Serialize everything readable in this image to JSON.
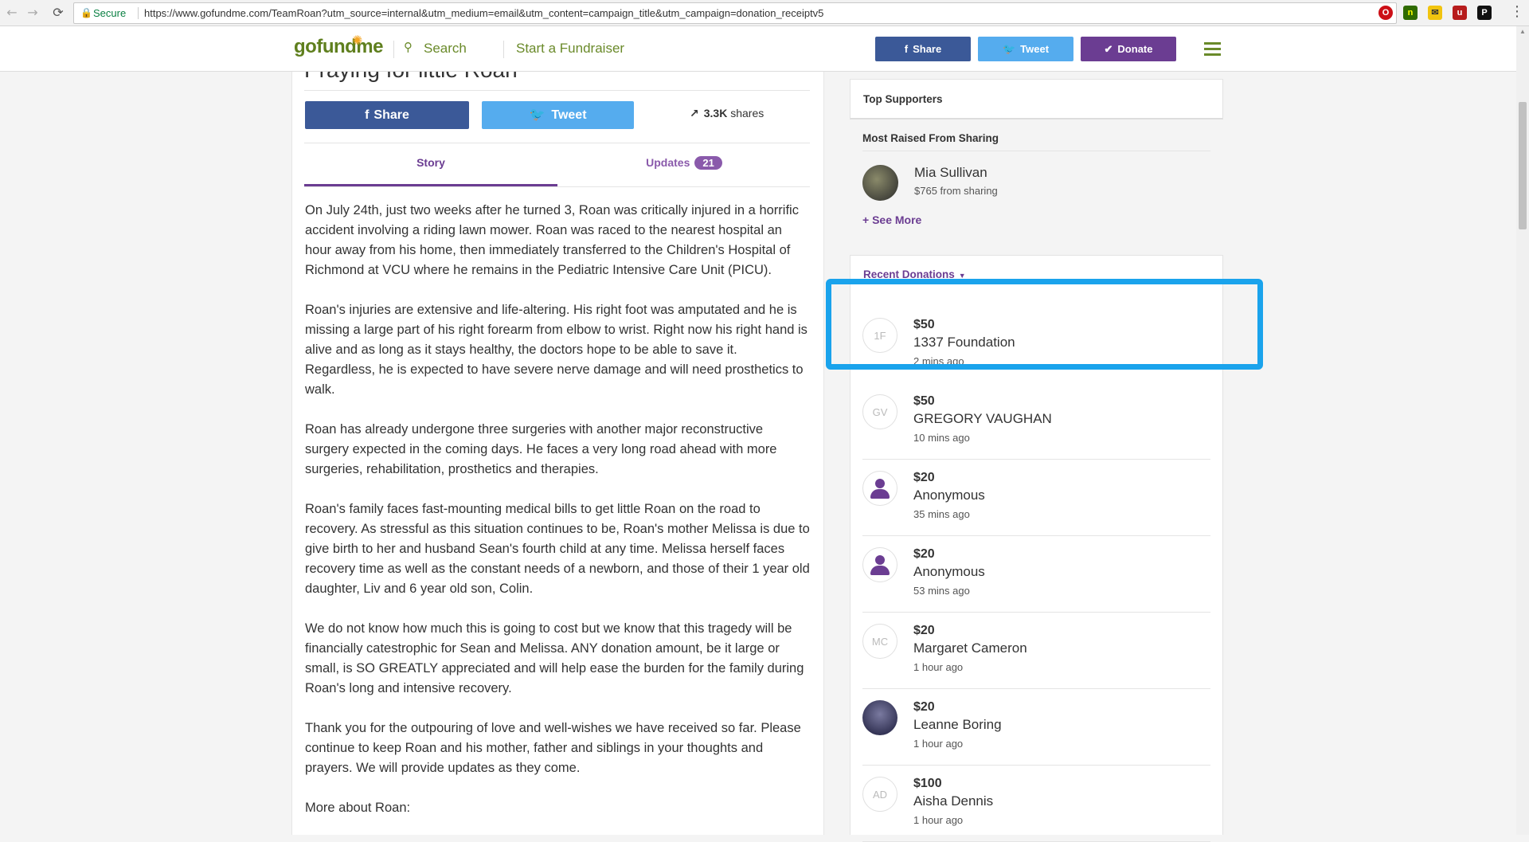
{
  "browser": {
    "secure_label": "Secure",
    "url": "https://www.gofundme.com/TeamRoan?utm_source=internal&utm_medium=email&utm_content=campaign_title&utm_campaign=donation_receiptv5"
  },
  "header": {
    "logo": "gofundme",
    "search_label": "Search",
    "start_label": "Start a Fundraiser",
    "share_label": "Share",
    "tweet_label": "Tweet",
    "donate_label": "Donate"
  },
  "campaign": {
    "title": "Praying for little Roan",
    "share_label": "Share",
    "tweet_label": "Tweet",
    "shares_count": "3.3K",
    "shares_label": "shares",
    "tabs": {
      "story": "Story",
      "updates": "Updates",
      "updates_count": "21"
    },
    "story": [
      "On July 24th, just two weeks after he turned 3, Roan was critically injured in a horrific accident involving a riding lawn mower. Roan was raced to the nearest hospital an hour away from his home, then immediately transferred to the Children's Hospital of Richmond at VCU where he remains in the Pediatric Intensive Care Unit (PICU).",
      "Roan's injuries are extensive and life-altering. His right foot was amputated and he is missing a large part of his right forearm from elbow to wrist.  Right now his right hand is alive and as long as it stays healthy, the doctors hope to be able to save it.  Regardless, he is expected to have severe nerve damage and will need prosthetics to walk.",
      "Roan has already undergone three surgeries with another major reconstructive surgery expected in the coming days.  He faces a very long road ahead with more surgeries, rehabilitation, prosthetics and therapies.",
      "Roan's family faces fast-mounting medical bills to get little Roan on the road to recovery.  As stressful as this situation continues to be, Roan's mother Melissa is due to give birth to her and husband Sean's fourth child at any time. Melissa herself faces recovery time as well as the constant needs of a newborn, and those of their 1 year old daughter, Liv and 6 year old son, Colin.",
      "We do not know how much this is going to cost but we know that this tragedy will be financially catestrophic for Sean and Melissa. ANY donation amount, be it large or small, is SO GREATLY appreciated and will help ease the burden for the family during Roan's long and intensive recovery.",
      "Thank you for the outpouring of love and well-wishes we have received so far.  Please continue to keep Roan and his mother, father and siblings in your thoughts and prayers. We will provide updates as they come.",
      "More about Roan:"
    ]
  },
  "sidebar": {
    "top_supporters_title": "Top Supporters",
    "most_raised_title": "Most Raised From Sharing",
    "top_sharer": {
      "name": "Mia Sullivan",
      "detail": "$765 from sharing"
    },
    "see_more_label": "See More",
    "recent_donations_title": "Recent Donations",
    "donations": [
      {
        "initials": "1F",
        "amount": "$50",
        "name": "1337 Foundation",
        "time": "2 mins ago",
        "avatar": "initials"
      },
      {
        "initials": "GV",
        "amount": "$50",
        "name": "GREGORY VAUGHAN",
        "time": "10 mins ago",
        "avatar": "initials"
      },
      {
        "initials": "",
        "amount": "$20",
        "name": "Anonymous",
        "time": "35 mins ago",
        "avatar": "person"
      },
      {
        "initials": "",
        "amount": "$20",
        "name": "Anonymous",
        "time": "53 mins ago",
        "avatar": "person"
      },
      {
        "initials": "MC",
        "amount": "$20",
        "name": "Margaret Cameron",
        "time": "1 hour ago",
        "avatar": "initials"
      },
      {
        "initials": "",
        "amount": "$20",
        "name": "Leanne Boring",
        "time": "1 hour ago",
        "avatar": "photo"
      },
      {
        "initials": "AD",
        "amount": "$100",
        "name": "Aisha Dennis",
        "time": "1 hour ago",
        "avatar": "initials"
      }
    ]
  },
  "colors": {
    "brand_green": "#6a8a2a",
    "facebook_blue": "#3b5998",
    "twitter_blue": "#55acee",
    "donate_purple": "#6b3d92",
    "highlight_blue": "#1aa3ec"
  }
}
